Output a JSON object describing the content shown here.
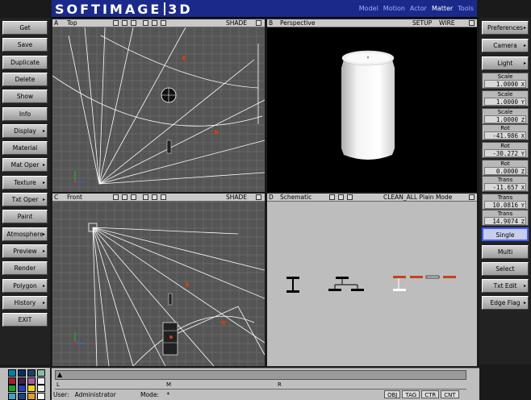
{
  "app": {
    "logo_left": "SOFTIMAGE",
    "logo_right": "3D",
    "modules": [
      "Model",
      "Motion",
      "Actor",
      "Matter",
      "Tools"
    ],
    "active_module": "Matter"
  },
  "left_menu": [
    "Get",
    "Save",
    "Duplicate",
    "Delete",
    "Show",
    "Info",
    "Display",
    "Material",
    "Mat Oper",
    "Texture",
    "Txt Oper",
    "Paint",
    "Atmosphere",
    "Preview",
    "Render",
    "Polygon",
    "History",
    "EXIT"
  ],
  "right_menu": {
    "preferences": "Preferences",
    "camera": "Camera",
    "light": "Light",
    "fields": [
      {
        "label": "Scale",
        "value": "1.0000",
        "axis": "X"
      },
      {
        "label": "Scale",
        "value": "1.0000",
        "axis": "Y"
      },
      {
        "label": "Scale",
        "value": "1.0000",
        "axis": "Z"
      },
      {
        "label": "Rot",
        "value": "-41.986",
        "axis": "X"
      },
      {
        "label": "Rot",
        "value": "-30.272",
        "axis": "Y"
      },
      {
        "label": "Rot",
        "value": "0.0000",
        "axis": "Z"
      },
      {
        "label": "Trans",
        "value": "-11.657",
        "axis": "X"
      },
      {
        "label": "Trans",
        "value": "10.0816",
        "axis": "Y"
      },
      {
        "label": "Trans",
        "value": "14.9074",
        "axis": "Z"
      }
    ],
    "single": "Single",
    "multi": "Multi",
    "select": "Select",
    "txt_edit": "Txt Edit",
    "edge_flag": "Edge Flag"
  },
  "views": {
    "top": {
      "letter": "A",
      "name": "Top",
      "mode": "SHADE"
    },
    "persp": {
      "letter": "B",
      "name": "Perspective",
      "setup": "SETUP",
      "mode": "WIRE"
    },
    "front": {
      "letter": "C",
      "name": "Front",
      "mode": "SHADE"
    },
    "schem": {
      "letter": "D",
      "name": "Schematic",
      "mode": "CLEAN_ALL Plain Mode"
    }
  },
  "timeline": {
    "marks": [
      "L",
      "M",
      "R"
    ],
    "user_label": "User:",
    "user": "Administrator",
    "mode_label": "Mode:",
    "mode": "*",
    "tabs": [
      "OBJ",
      "TAG",
      "CTR",
      "CNT"
    ]
  },
  "colors": {
    "accent": "#1b2a8a",
    "wire": "#ffffff",
    "viewport_bg": "#5a5a5a",
    "render_bg": "#000000",
    "light_marker": "#c8401a"
  },
  "palette": [
    "#0080a0",
    "#003060",
    "#204060",
    "#80c0a0",
    "#a02030",
    "#402040",
    "#a060a0",
    "#f0f0f0",
    "#20a020",
    "#2040c0",
    "#f0d020",
    "#f0f0f0",
    "#40a0c0",
    "#204080",
    "#e0a030",
    "#ffffff"
  ]
}
